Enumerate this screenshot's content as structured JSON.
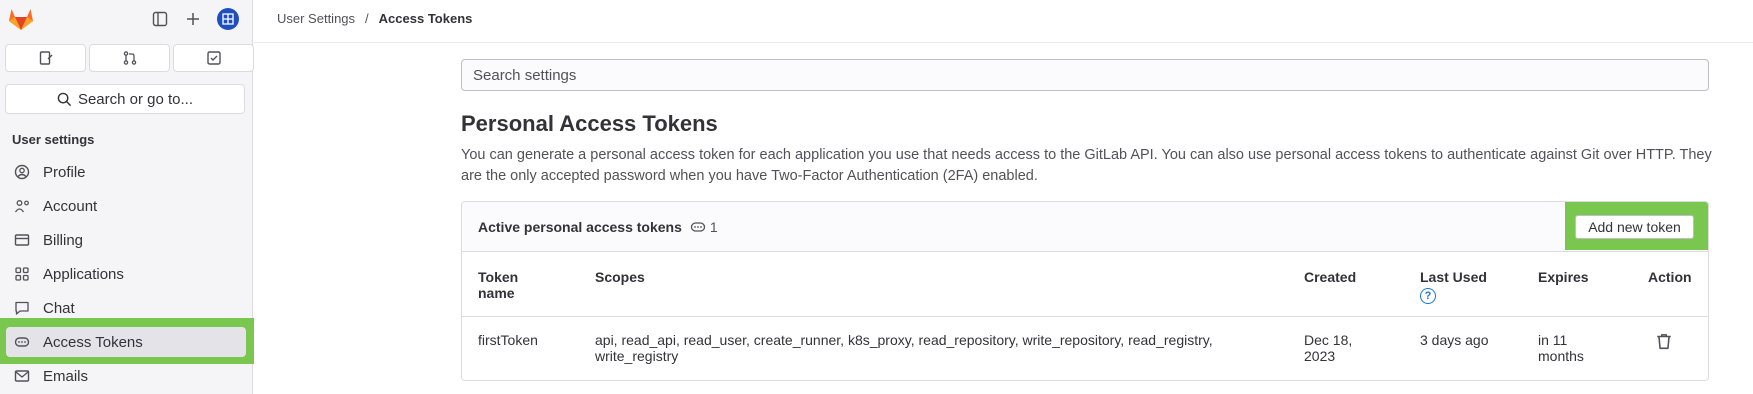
{
  "sidebar": {
    "search_label": "Search or go to...",
    "section_heading": "User settings",
    "items": [
      {
        "label": "Profile",
        "icon": "user-circle-icon"
      },
      {
        "label": "Account",
        "icon": "account-icon"
      },
      {
        "label": "Billing",
        "icon": "billing-icon"
      },
      {
        "label": "Applications",
        "icon": "applications-icon"
      },
      {
        "label": "Chat",
        "icon": "chat-icon"
      },
      {
        "label": "Access Tokens",
        "icon": "token-icon",
        "active": true
      },
      {
        "label": "Emails",
        "icon": "mail-icon"
      }
    ]
  },
  "breadcrumb": {
    "parent": "User Settings",
    "separator": "/",
    "current": "Access Tokens"
  },
  "search_settings": {
    "placeholder": "Search settings"
  },
  "page": {
    "title": "Personal Access Tokens",
    "description": "You can generate a personal access token for each application you use that needs access to the GitLab API. You can also use personal access tokens to authenticate against Git over HTTP. They are the only accepted password when you have Two-Factor Authentication (2FA) enabled."
  },
  "tokens_card": {
    "title": "Active personal access tokens",
    "count": "1",
    "add_button": "Add new token",
    "columns": {
      "name_line1": "Token",
      "name_line2": "name",
      "scopes": "Scopes",
      "created": "Created",
      "last_used": "Last Used",
      "expires": "Expires",
      "action": "Action"
    },
    "rows": [
      {
        "name": "firstToken",
        "scopes_line1": "api, read_api, read_user, create_runner, k8s_proxy, read_repository, write_repository, read_registry,",
        "scopes_line2": "write_registry",
        "created_line1": "Dec 18,",
        "created_line2": "2023",
        "last_used": "3 days ago",
        "expires_line1": "in 11",
        "expires_line2": "months"
      }
    ]
  },
  "colors": {
    "highlight": "#7ac74f",
    "brand": "#fc6d26",
    "link": "#1f75cb"
  }
}
